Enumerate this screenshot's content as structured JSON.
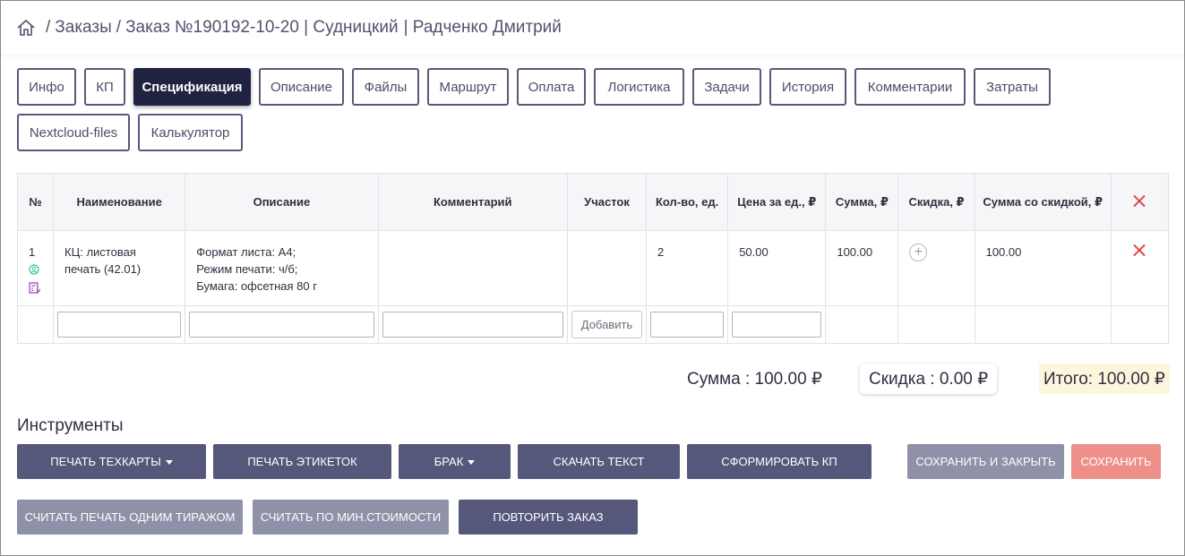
{
  "breadcrumb": {
    "home_icon": "home-icon",
    "parts": [
      "Заказы",
      "Заказ №190192-10-20 | Судницкий",
      "| Радченко Дмитрий"
    ]
  },
  "tabs": {
    "row1": [
      "Инфо",
      "КП",
      "Спецификация",
      "Описание",
      "Файлы",
      "Маршрут",
      "Оплата",
      "Логистика",
      "Задачи",
      "История",
      "Комментарии",
      "Затраты"
    ],
    "row2": [
      "Nextcloud-files",
      "Калькулятор"
    ],
    "active": "Спецификация"
  },
  "table": {
    "headers": [
      "№",
      "Наименование",
      "Описание",
      "Комментарий",
      "Участок",
      "Кол-во, ед.",
      "Цена за ед., ₽",
      "Сумма, ₽",
      "Скидка, ₽",
      "Сумма со скидкой, ₽"
    ],
    "rows": [
      {
        "num": "1",
        "name": "КЦ: листовая печать (42.01)",
        "description": [
          "Формат листа: А4;",
          "Режим печати: ч/б;",
          "Бумага: офсетная 80 г"
        ],
        "comment": "",
        "section": "",
        "qty": "2",
        "price": "50.00",
        "sum": "100.00",
        "discount": "",
        "sum_discount": "100.00"
      }
    ],
    "add_button": "Добавить"
  },
  "totals": {
    "sum": "Сумма : 100.00 ₽",
    "discount": "Скидка : 0.00 ₽",
    "total": "Итого: 100.00 ₽"
  },
  "tools": {
    "title": "Инструменты",
    "print_techcard": "ПЕЧАТЬ ТЕХКАРТЫ",
    "print_labels": "ПЕЧАТЬ ЭТИКЕТОК",
    "defect": "БРАК",
    "download_text": "СКАЧАТЬ ТЕКСТ",
    "make_kp": "СФОРМИРОВАТЬ КП",
    "save_close": "СОХРАНИТЬ И ЗАКРЫТЬ",
    "save": "СОХРАНИТЬ",
    "calc_one_run": "СЧИТАТЬ ПЕЧАТЬ ОДНИМ ТИРАЖОМ",
    "calc_min_cost": "СЧИТАТЬ ПО МИН.СТОИМОСТИ",
    "repeat_order": "ПОВТОРИТЬ ЗАКАЗ"
  },
  "colors": {
    "primary_button": "#55587a",
    "muted_button": "#8e91a8",
    "danger_button": "#ef8f8a",
    "active_tab": "#1f2240",
    "delete_icon": "#e04848"
  }
}
